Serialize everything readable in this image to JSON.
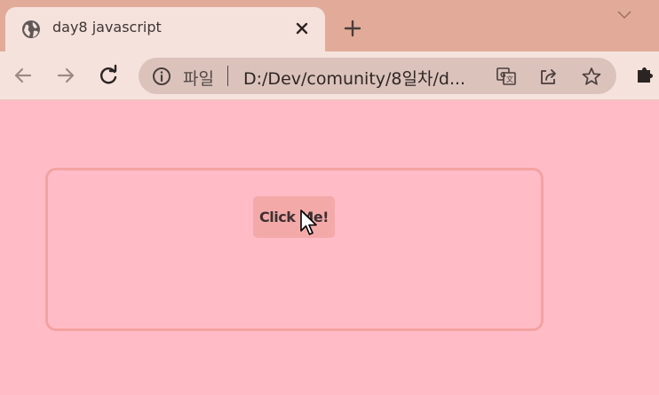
{
  "browser": {
    "tab": {
      "title": "day8 javascript"
    },
    "omnibox": {
      "scheme_label": "파일",
      "url": "D:/Dev/comunity/8일차/d..."
    }
  },
  "page": {
    "button_label": "Click Me!"
  },
  "colors": {
    "page_background": "#ffbcc7",
    "box_border": "#f4a2a1",
    "button_background": "#f4a9a9",
    "tabstrip": "#e2ab99",
    "toolbar": "#f6e2dc"
  }
}
